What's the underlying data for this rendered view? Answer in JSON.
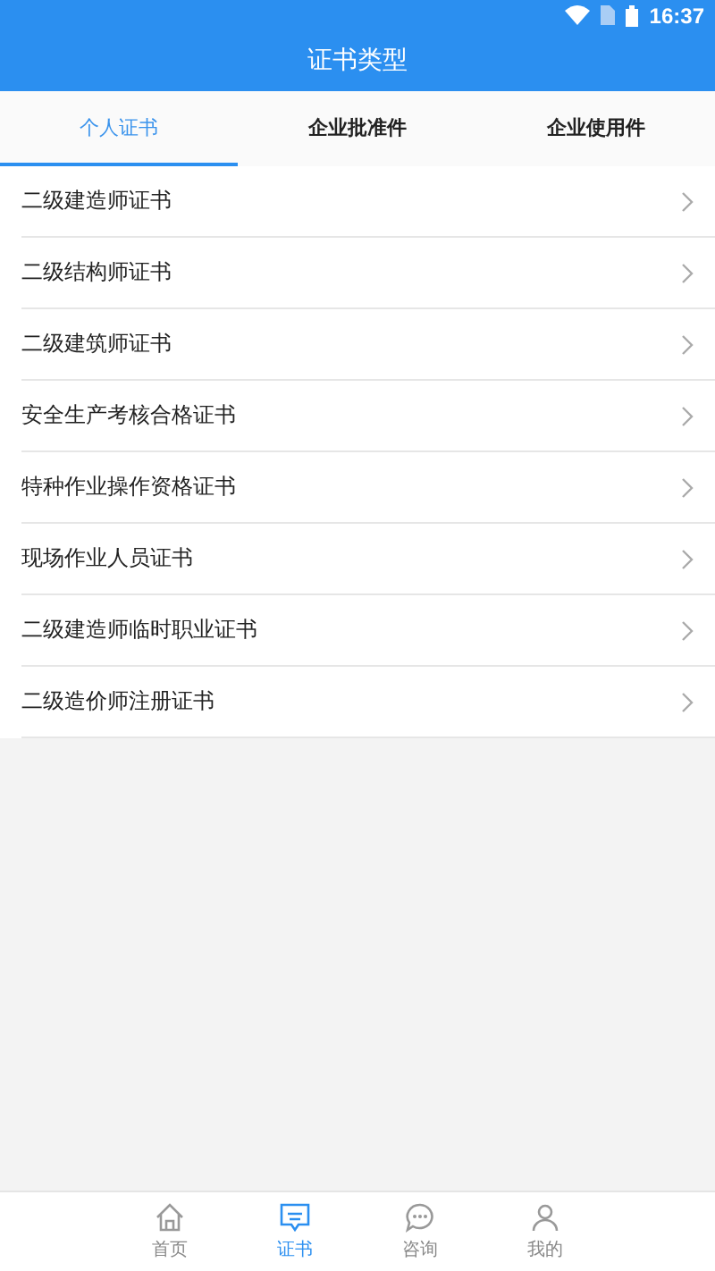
{
  "status_bar": {
    "time": "16:37"
  },
  "header": {
    "title": "证书类型"
  },
  "tabs": [
    {
      "label": "个人证书",
      "selected": true
    },
    {
      "label": "企业批准件",
      "selected": false
    },
    {
      "label": "企业使用件",
      "selected": false
    }
  ],
  "items": [
    {
      "label": "二级建造师证书"
    },
    {
      "label": "二级结构师证书"
    },
    {
      "label": "二级建筑师证书"
    },
    {
      "label": "安全生产考核合格证书"
    },
    {
      "label": "特种作业操作资格证书"
    },
    {
      "label": "现场作业人员证书"
    },
    {
      "label": "二级建造师临时职业证书"
    },
    {
      "label": "二级造价师注册证书"
    }
  ],
  "bottom_nav": [
    {
      "kind": "home",
      "label": "首页",
      "selected": false
    },
    {
      "kind": "certificate",
      "label": "证书",
      "selected": true
    },
    {
      "kind": "chat",
      "label": "咨询",
      "selected": false
    },
    {
      "kind": "person",
      "label": "我的",
      "selected": false
    }
  ]
}
